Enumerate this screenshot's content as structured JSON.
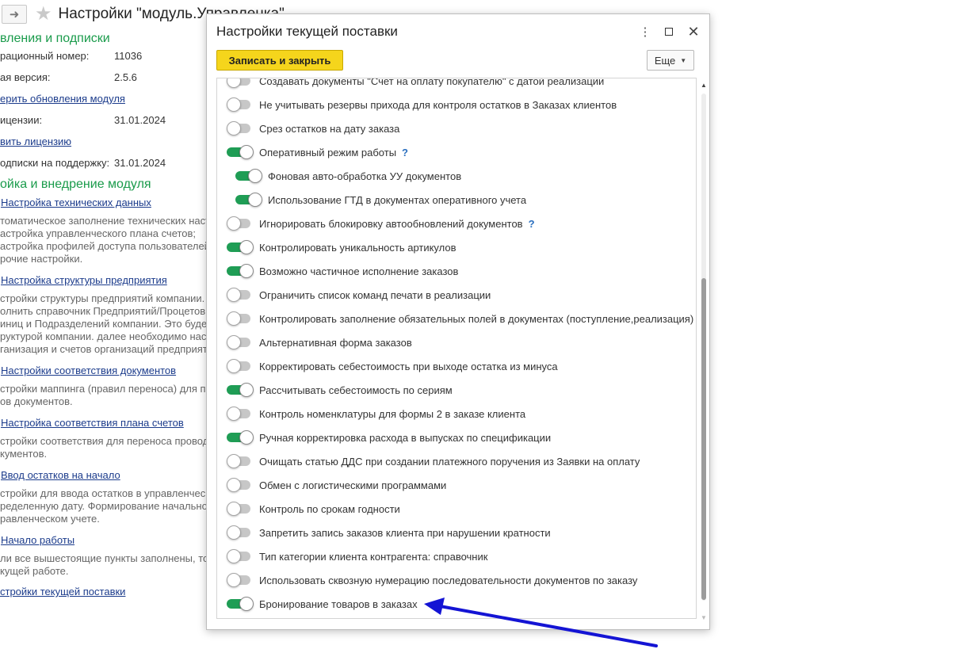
{
  "background": {
    "title": "Настройки \"модуль.Управленка\"",
    "section_updates": "вления и подписки",
    "reg_number_label": "рационный номер:",
    "reg_number_value": "11036",
    "version_label": "ая версия:",
    "version_value": "2.5.6",
    "check_updates_link": "ерить обновления модуля",
    "license_label": "ицензии:",
    "license_value": "31.01.2024",
    "renew_license_link": "вить лицензию",
    "support_label": "одписки на поддержку:",
    "support_value": "31.01.2024",
    "section_setup": "ойка и внедрение модуля",
    "items": [
      {
        "link": "Настройка технических данных",
        "desc": [
          "томатическое заполнение технических наст",
          "астройка управленческого плана счетов;",
          "астройка профилей доступа пользователей;",
          "рочие настройки."
        ]
      },
      {
        "link": "Настройка структуры предприятия",
        "desc": [
          "стройки структуры предприятий компании.",
          "олнить справочник Предприятий/Процетов",
          "иниц и Подразделений компании. Это будет",
          "руктурой компании. далее необходимо наст",
          "ганизация и счетов организаций предприяти"
        ]
      },
      {
        "link": "Настройки соответствия документов",
        "desc": [
          "стройки маппинга (правил переноса) для пр",
          "ов документов."
        ]
      },
      {
        "link": "Настройка соответствия плана счетов",
        "desc": [
          "стройки соответствия для переноса провод",
          "кументов."
        ]
      },
      {
        "link": "Ввод остатков на начало",
        "desc": [
          "стройки для ввода остатков в управленчес",
          "ределенную дату. Формирование начально",
          "равленческом учете."
        ]
      },
      {
        "link": "Начало работы",
        "desc": [
          "ли все вышестоящие пункты заполнены, то",
          "кущей работе."
        ]
      }
    ],
    "current_supply_link": "стройки текущей поставки"
  },
  "dialog": {
    "title": "Настройки текущей поставки",
    "save_close_label": "Записать и закрыть",
    "more_label": "Еще",
    "settings": [
      {
        "label": "Создавать документы \"Счет на оплату покупателю\" с датой реализации",
        "on": false,
        "indent": false,
        "help": false
      },
      {
        "label": "Не учитывать резервы прихода для контроля остатков в Заказах клиентов",
        "on": false,
        "indent": false,
        "help": false
      },
      {
        "label": "Срез остатков на дату заказа",
        "on": false,
        "indent": false,
        "help": false
      },
      {
        "label": "Оперативный режим работы",
        "on": true,
        "indent": false,
        "help": true
      },
      {
        "label": "Фоновая авто-обработка УУ документов",
        "on": true,
        "indent": true,
        "help": false
      },
      {
        "label": "Использование ГТД в документах оперативного учета",
        "on": true,
        "indent": true,
        "help": false
      },
      {
        "label": "Игнорировать блокировку автообновлений документов",
        "on": false,
        "indent": false,
        "help": true
      },
      {
        "label": "Контролировать уникальность артикулов",
        "on": true,
        "indent": false,
        "help": false
      },
      {
        "label": "Возможно частичное исполнение заказов",
        "on": true,
        "indent": false,
        "help": false
      },
      {
        "label": "Ограничить список команд печати в реализации",
        "on": false,
        "indent": false,
        "help": false
      },
      {
        "label": "Контролировать заполнение обязательных полей в документах (поступление,реализация)",
        "on": false,
        "indent": false,
        "help": false
      },
      {
        "label": "Альтернативная форма заказов",
        "on": false,
        "indent": false,
        "help": false
      },
      {
        "label": "Корректировать себестоимость при выходе остатка из минуса",
        "on": false,
        "indent": false,
        "help": false
      },
      {
        "label": "Рассчитывать себестоимость по сериям",
        "on": true,
        "indent": false,
        "help": false
      },
      {
        "label": "Контроль номенклатуры для формы 2 в заказе клиента",
        "on": false,
        "indent": false,
        "help": false
      },
      {
        "label": "Ручная корректировка расхода в выпусках по спецификации",
        "on": true,
        "indent": false,
        "help": false
      },
      {
        "label": "Очищать статью ДДС при создании платежного поручения из Заявки на оплату",
        "on": false,
        "indent": false,
        "help": false
      },
      {
        "label": "Обмен с логистическими программами",
        "on": false,
        "indent": false,
        "help": false
      },
      {
        "label": "Контроль по срокам годности",
        "on": false,
        "indent": false,
        "help": false
      },
      {
        "label": "Запретить запись заказов клиента при нарушении кратности",
        "on": false,
        "indent": false,
        "help": false
      },
      {
        "label": "Тип категории клиента контрагента: справочник",
        "on": false,
        "indent": false,
        "help": false
      },
      {
        "label": "Использовать сквозную нумерацию последовательности документов по заказу",
        "on": false,
        "indent": false,
        "help": false
      },
      {
        "label": "Бронирование товаров в заказах",
        "on": true,
        "indent": false,
        "help": false
      }
    ]
  },
  "icons": {
    "back": "arrow-right-icon",
    "favorite": "star-icon",
    "menu": "more-vertical-icon",
    "maximize": "maximize-icon",
    "close": "close-icon",
    "help": "help-icon",
    "annotation": "blue-arrow-annotation"
  },
  "colors": {
    "accent_green": "#1f9d55",
    "section_green": "#1a9b4b",
    "link_blue": "#1c3c8c",
    "primary_button": "#f5d51c",
    "annotation_arrow": "#1414d4"
  }
}
